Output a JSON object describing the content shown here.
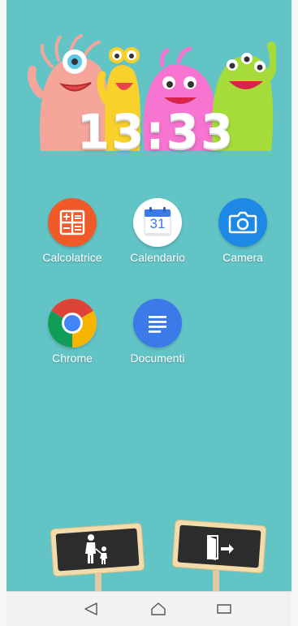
{
  "clock": {
    "time": "13:33"
  },
  "apps": [
    {
      "label": "Calcolatrice",
      "icon": "calculator-icon"
    },
    {
      "label": "Calendario",
      "icon": "calendar-icon",
      "day": "31"
    },
    {
      "label": "Camera",
      "icon": "camera-icon"
    },
    {
      "label": "Chrome",
      "icon": "chrome-icon"
    },
    {
      "label": "Documenti",
      "icon": "docs-icon"
    }
  ],
  "signs": [
    {
      "icon": "parent-child-icon"
    },
    {
      "icon": "exit-door-icon"
    }
  ],
  "navbar": {
    "buttons": [
      {
        "icon": "back-icon"
      },
      {
        "icon": "home-icon"
      },
      {
        "icon": "recents-icon"
      }
    ]
  },
  "colors": {
    "background": "#63c4c5",
    "calculator": "#f05a28",
    "camera": "#1e88e5",
    "docs": "#3b7ae8",
    "chalkboard": "#2c2c2c",
    "sign_frame": "#f3dbab"
  }
}
